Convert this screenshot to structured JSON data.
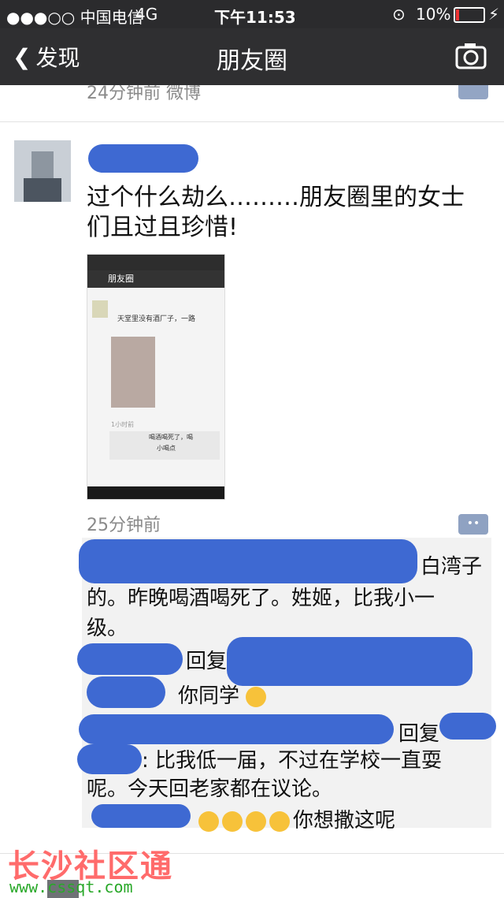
{
  "status_bar": {
    "carrier": "●●●○○ 中国电信",
    "network": "4G",
    "time": "下午11:53",
    "battery": "10%"
  },
  "navbar": {
    "back_label": "发现",
    "title": "朋友圈"
  },
  "previous_post": {
    "meta": "24分钟前  微博"
  },
  "post": {
    "text": "过个什么劫么………朋友圈里的女士们且过且珍惜!",
    "time": "25分钟前"
  },
  "thumbnail": {
    "title": "朋友圈",
    "caption1": "天堂里没有酒厂子，一路",
    "caption2": "1小时前",
    "caption3": "喝酒喝死了，喝",
    "caption4": "小喝点"
  },
  "comments": {
    "c1_end": "白湾子",
    "c1_line2": "的。昨晚喝酒喝死了。姓姬，比我小一",
    "c1_line3": "级。",
    "c2_reply": "回复",
    "c2_text": "你同学",
    "c3_reply": "回复",
    "c3_line1": "比我低一届，不过在学校一直耍",
    "c3_line2": "呢。今天回老家都在议论。",
    "c4_text": "你想撒这呢"
  },
  "watermark": {
    "line1": "长沙社区通",
    "line2": "www.cssqt.com"
  },
  "colors": {
    "redaction": "#3e69d2",
    "nav_bg": "#2f2f31"
  }
}
